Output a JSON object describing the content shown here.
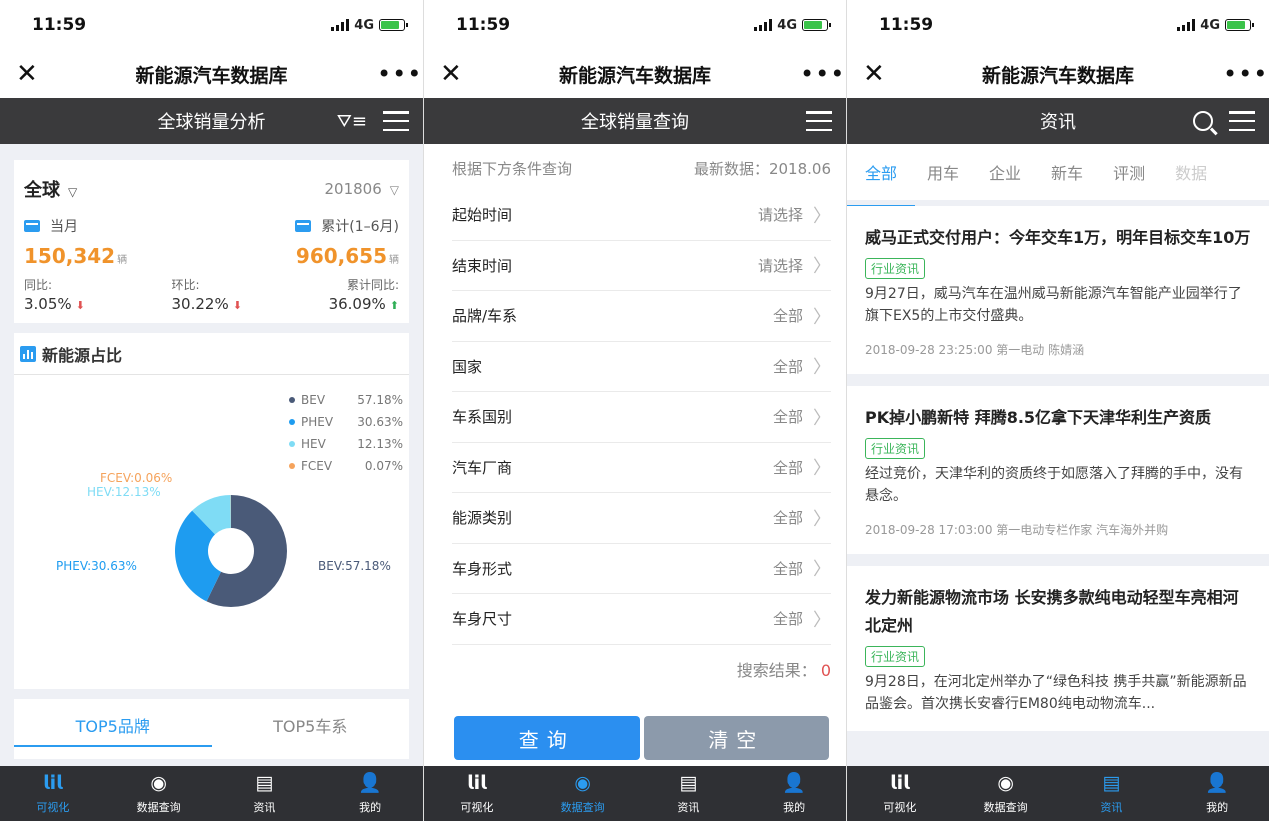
{
  "status": {
    "time": "11:59",
    "network": "4G"
  },
  "app_title": "新能源汽车数据库",
  "tabbar": [
    {
      "label": "可视化",
      "icon": "chart-icon"
    },
    {
      "label": "数据查询",
      "icon": "search-data-icon"
    },
    {
      "label": "资讯",
      "icon": "news-icon"
    },
    {
      "label": "我的",
      "icon": "user-icon"
    }
  ],
  "screen1": {
    "header": "全球销量分析",
    "region": "全球",
    "period": "201806",
    "month_label": "当月",
    "cumulative_label": "累计(1–6月)",
    "month_value": "150,342",
    "cumulative_value": "960,655",
    "unit": "辆",
    "yoy_label": "同比:",
    "yoy_value": "3.05%",
    "mom_label": "环比:",
    "mom_value": "30.22%",
    "cum_yoy_label": "累计同比:",
    "cum_yoy_value": "36.09%",
    "share_title": "新能源占比",
    "top5_brand": "TOP5品牌",
    "top5_series": "TOP5车系",
    "colors": {
      "BEV": "#4a5a78",
      "PHEV": "#1e9cf0",
      "HEV": "#7fdcf5",
      "FCEV": "#f5a35c"
    },
    "legend": [
      {
        "name": "BEV",
        "pct": "57.18%"
      },
      {
        "name": "PHEV",
        "pct": "30.63%"
      },
      {
        "name": "HEV",
        "pct": "12.13%"
      },
      {
        "name": "FCEV",
        "pct": "0.07%"
      }
    ],
    "pie_labels": {
      "fcev": "FCEV:0.06%",
      "hev": "HEV:12.13%",
      "phev": "PHEV:30.63%",
      "bev": "BEV:57.18%"
    },
    "chart_data": {
      "type": "pie",
      "categories": [
        "BEV",
        "PHEV",
        "HEV",
        "FCEV"
      ],
      "values": [
        57.18,
        30.63,
        12.13,
        0.07
      ],
      "title": "新能源占比"
    }
  },
  "screen2": {
    "header": "全球销量查询",
    "hint": "根据下方条件查询",
    "latest": "最新数据：2018.06",
    "rows": [
      {
        "label": "起始时间",
        "value": "请选择"
      },
      {
        "label": "结束时间",
        "value": "请选择"
      },
      {
        "label": "品牌/车系",
        "value": "全部"
      },
      {
        "label": "国家",
        "value": "全部"
      },
      {
        "label": "车系国别",
        "value": "全部"
      },
      {
        "label": "汽车厂商",
        "value": "全部"
      },
      {
        "label": "能源类别",
        "value": "全部"
      },
      {
        "label": "车身形式",
        "value": "全部"
      },
      {
        "label": "车身尺寸",
        "value": "全部"
      }
    ],
    "result_label": "搜索结果：",
    "result_count": "0",
    "query_btn": "查询",
    "clear_btn": "清空"
  },
  "screen3": {
    "header": "资讯",
    "categories": [
      "全部",
      "用车",
      "企业",
      "新车",
      "评测",
      "数据"
    ],
    "news": [
      {
        "title": "威马正式交付用户：今年交车1万，明年目标交车10万",
        "tag": "行业资讯",
        "summary": "9月27日，威马汽车在温州威马新能源汽车智能产业园举行了旗下EX5的上市交付盛典。",
        "meta": "2018-09-28 23:25:00 第一电动 陈婧涵"
      },
      {
        "title": "PK掉小鹏新特 拜腾8.5亿拿下天津华利生产资质",
        "tag": "行业资讯",
        "summary": "经过竞价，天津华利的资质终于如愿落入了拜腾的手中，没有悬念。",
        "meta": "2018-09-28 17:03:00 第一电动专栏作家 汽车海外并购"
      },
      {
        "title": "发力新能源物流市场 长安携多款纯电动轻型车亮相河北定州",
        "tag": "行业资讯",
        "summary": "9月28日，在河北定州举办了“绿色科技 携手共赢”新能源新品品鉴会。首次携长安睿行EM80纯电动物流车...",
        "meta": ""
      }
    ]
  }
}
